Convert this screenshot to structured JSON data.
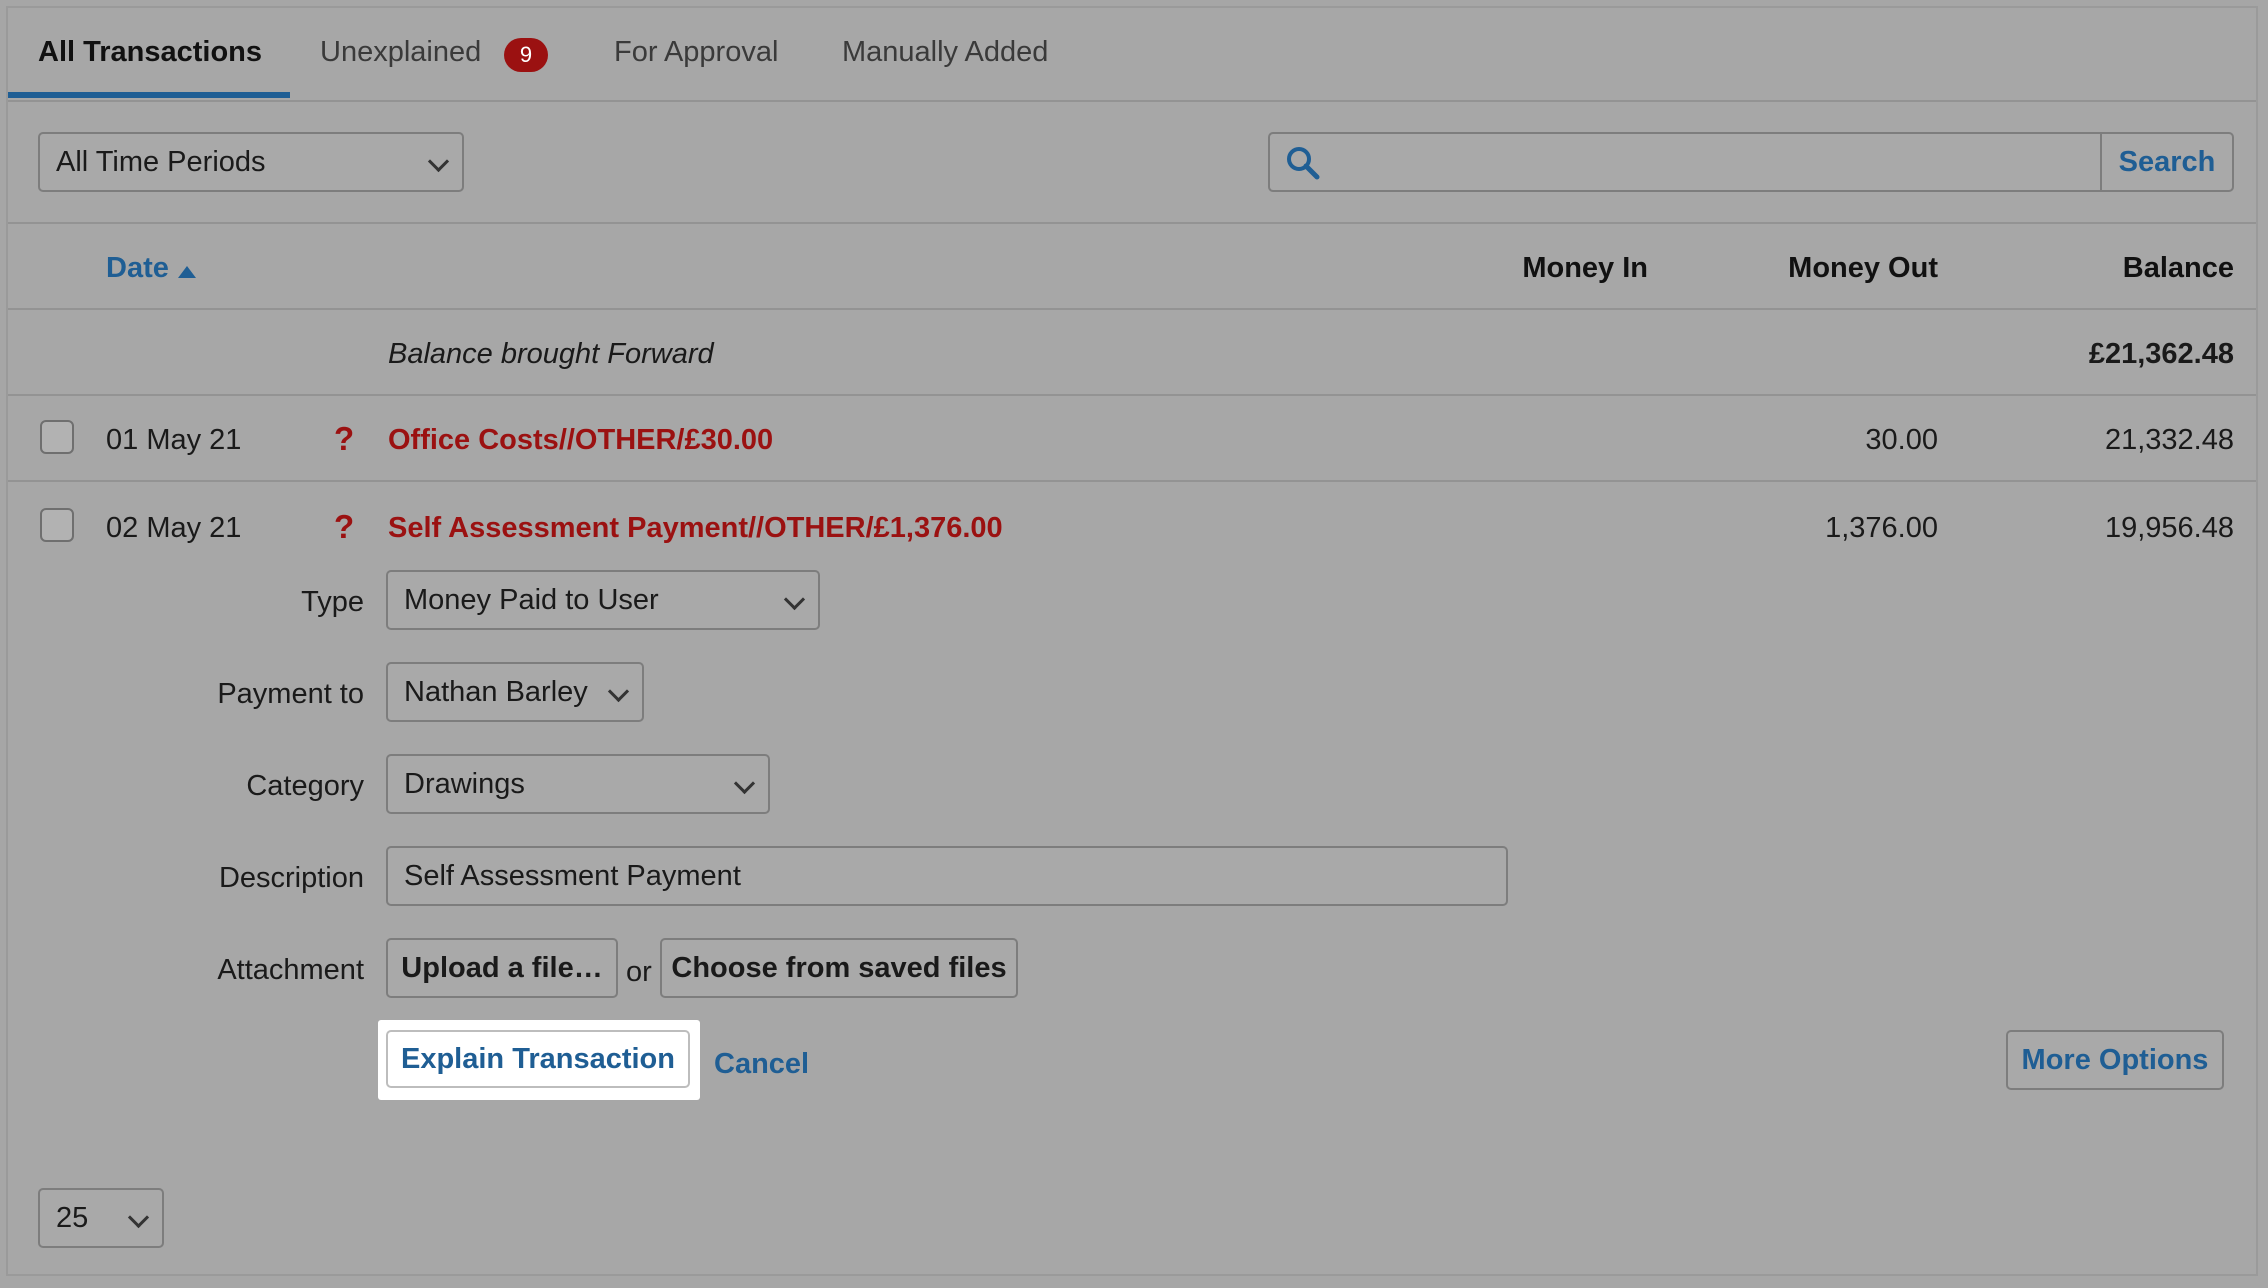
{
  "tabs": [
    {
      "label": "All Transactions",
      "active": true
    },
    {
      "label": "Unexplained",
      "badge": "9"
    },
    {
      "label": "For Approval"
    },
    {
      "label": "Manually Added"
    }
  ],
  "filter": {
    "period": "All Time Periods"
  },
  "search": {
    "button": "Search",
    "value": ""
  },
  "table": {
    "headers": {
      "date": "Date",
      "money_in": "Money In",
      "money_out": "Money Out",
      "balance": "Balance"
    },
    "brought_forward": {
      "label": "Balance brought Forward",
      "balance": "£21,362.48"
    },
    "rows": [
      {
        "date": "01 May 21",
        "flag": "?",
        "description": "Office Costs//OTHER/£30.00",
        "money_out": "30.00",
        "balance": "21,332.48"
      },
      {
        "date": "02 May 21",
        "flag": "?",
        "description": "Self Assessment Payment//OTHER/£1,376.00",
        "money_out": "1,376.00",
        "balance": "19,956.48"
      }
    ]
  },
  "form": {
    "type": {
      "label": "Type",
      "value": "Money Paid to User"
    },
    "payment_to": {
      "label": "Payment to",
      "value": "Nathan Barley"
    },
    "category": {
      "label": "Category",
      "value": "Drawings"
    },
    "description": {
      "label": "Description",
      "value": "Self Assessment Payment"
    },
    "attachment": {
      "label": "Attachment",
      "upload": "Upload a file…",
      "or": "or",
      "choose": "Choose from saved files"
    },
    "explain": "Explain Transaction",
    "cancel": "Cancel",
    "more_options": "More Options"
  },
  "pagination": {
    "per_page": "25"
  },
  "colors": {
    "accent": "#1f5e94",
    "alert": "#9b1111"
  }
}
